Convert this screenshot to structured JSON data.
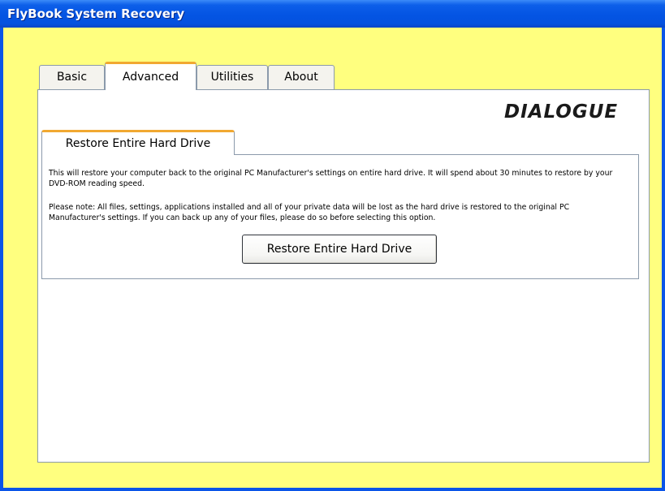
{
  "window": {
    "title": "FlyBook System Recovery"
  },
  "tabs": [
    {
      "label": "Basic",
      "active": false
    },
    {
      "label": "Advanced",
      "active": true
    },
    {
      "label": "Utilities",
      "active": false
    },
    {
      "label": "About",
      "active": false
    }
  ],
  "brand": {
    "logo_text": "DIALOGUE"
  },
  "subtab": {
    "label": "Restore Entire Hard Drive"
  },
  "panel": {
    "description": "This will restore your computer back to the original PC Manufacturer's settings on entire hard drive. It will spend about 30 minutes to restore by your DVD-ROM reading speed.",
    "note": "Please note: All files, settings, applications installed and all of your private data will be lost as the hard drive is restored to the original PC Manufacturer's settings.  If you can back up any of your files, please do so before selecting this option.",
    "button_label": "Restore Entire Hard Drive"
  },
  "colors": {
    "titlebar": "#0454e3",
    "client_background": "#ffff7f",
    "tab_accent": "#f1a831",
    "border": "#8b9aab"
  }
}
